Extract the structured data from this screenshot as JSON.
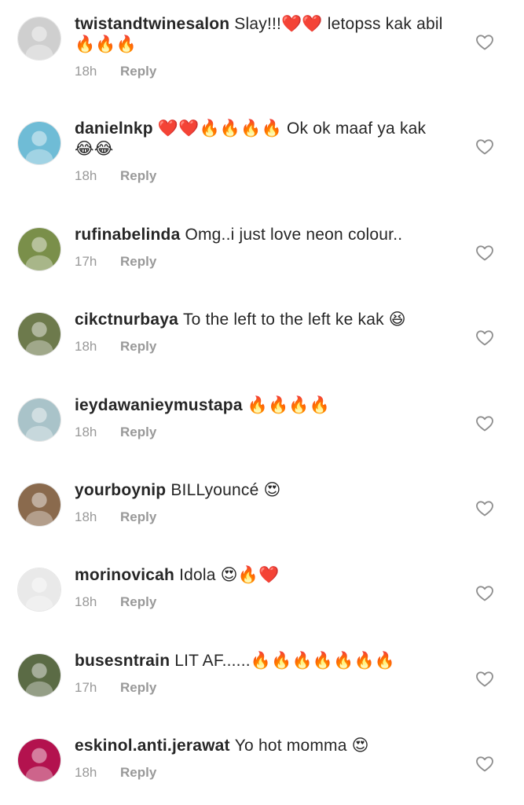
{
  "comments": [
    {
      "username": "twistandtwinesalon",
      "text": "Slay!!!❤️❤️ letopss kak abil🔥🔥🔥",
      "time": "18h",
      "reply_label": "Reply",
      "avatar_color": "#cfcfcf"
    },
    {
      "username": "danielnkp",
      "text": "❤️❤️🔥🔥🔥🔥 Ok ok maaf ya kak 😂😂",
      "time": "18h",
      "reply_label": "Reply",
      "avatar_color": "#6fbcd6"
    },
    {
      "username": "rufinabelinda",
      "text": "Omg..i just love neon colour..",
      "time": "17h",
      "reply_label": "Reply",
      "avatar_color": "#7a8f4a"
    },
    {
      "username": "cikctnurbaya",
      "text": "To the left to the left ke kak 😆",
      "time": "18h",
      "reply_label": "Reply",
      "avatar_color": "#6d7a4c"
    },
    {
      "username": "ieydawanieymustapa",
      "text": "🔥🔥🔥🔥",
      "time": "18h",
      "reply_label": "Reply",
      "avatar_color": "#a9c3c9"
    },
    {
      "username": "yourboynip",
      "text": "BILLyouncé 😍",
      "time": "18h",
      "reply_label": "Reply",
      "avatar_color": "#8a6a4d"
    },
    {
      "username": "morinovicah",
      "text": "Idola 😍🔥❤️",
      "time": "18h",
      "reply_label": "Reply",
      "avatar_color": "#e9e9e9"
    },
    {
      "username": "busesntrain",
      "text": "LIT AF......🔥🔥🔥🔥🔥🔥🔥",
      "time": "17h",
      "reply_label": "Reply",
      "avatar_color": "#5b6b45"
    },
    {
      "username": "eskinol.anti.jerawat",
      "text": "Yo hot momma 😍",
      "time": "18h",
      "reply_label": "Reply",
      "avatar_color": "#b3124e"
    }
  ],
  "icons": {
    "like": "heart-outline-icon"
  },
  "colors": {
    "text": "#262626",
    "meta": "#999999",
    "heart": "#8e8e8e"
  }
}
